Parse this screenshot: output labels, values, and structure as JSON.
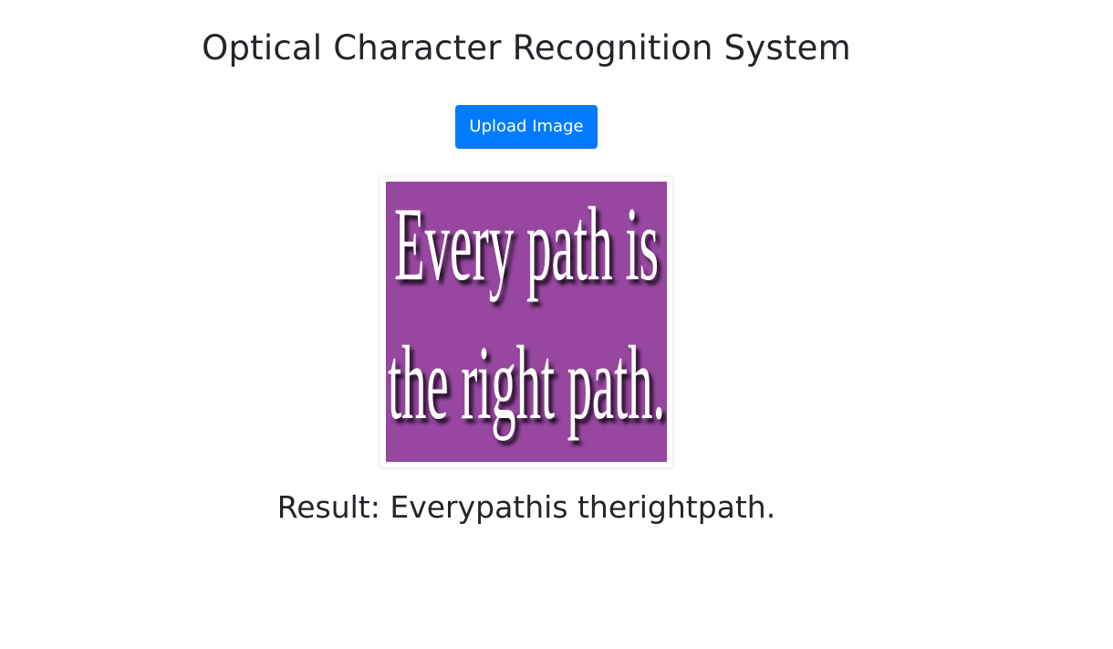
{
  "page": {
    "title": "Optical Character Recognition System"
  },
  "upload": {
    "button_label": "Upload Image"
  },
  "image": {
    "background_color": "#9747a0",
    "text_color": "#ffffff",
    "line1": "Every path is",
    "line2": "the right path."
  },
  "result": {
    "label": "Result: ",
    "text": "Everypathis therightpath."
  },
  "colors": {
    "accent": "#007bff",
    "text": "#212529"
  }
}
